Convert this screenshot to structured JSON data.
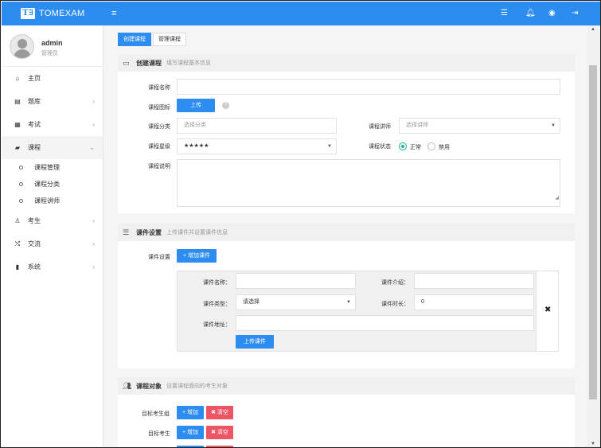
{
  "app": {
    "logo_mark": "T∃",
    "title": "TOMEXAM"
  },
  "topbar": {
    "menu_icon": "hamburger-icon",
    "icons": [
      "list-icon",
      "bell-icon",
      "user-circle-icon",
      "logout-icon"
    ]
  },
  "user": {
    "name": "admin",
    "role": "管理员"
  },
  "sidebar": {
    "items": [
      {
        "label": "主页",
        "icon": "home-icon",
        "glyph": "⌂"
      },
      {
        "label": "题库",
        "icon": "database-icon",
        "glyph": "▤"
      },
      {
        "label": "考试",
        "icon": "calendar-icon",
        "glyph": "▦"
      },
      {
        "label": "课程",
        "icon": "book-icon",
        "glyph": "▰"
      },
      {
        "label": "考生",
        "icon": "user-icon",
        "glyph": "♙"
      },
      {
        "label": "交流",
        "icon": "shuffle-icon",
        "glyph": "⤭"
      },
      {
        "label": "系统",
        "icon": "mobile-icon",
        "glyph": "▮"
      }
    ],
    "sub_items": [
      "课程管理",
      "课程分类",
      "课程讲师"
    ]
  },
  "tabs": {
    "create": "创建课程",
    "manage": "管理课程"
  },
  "section1": {
    "title": "创建课程",
    "subtitle": "填写课程基本信息",
    "name_label": "课程名称",
    "icon_label": "课程图标",
    "upload_label": "上传",
    "category_label": "课程分类",
    "category_placeholder": "选择分类",
    "teacher_label": "课程讲师",
    "teacher_placeholder": "选择讲师",
    "level_label": "课程星级",
    "level_value": "★★★★★",
    "status_label": "课程状态",
    "status_normal": "正常",
    "status_disabled": "禁用",
    "desc_label": "课程说明"
  },
  "section2": {
    "title": "课件设置",
    "subtitle": "上传课件并设置课件信息",
    "setting_label": "课件设置",
    "add_button": "+ 增加课件",
    "cw_name_label": "课件名称：",
    "cw_intro_label": "课件介绍：",
    "cw_type_label": "课件类型：",
    "cw_type_placeholder": "请选择",
    "cw_duration_label": "课件时长：",
    "cw_duration_value": "0",
    "cw_url_label": "课件地址：",
    "cw_upload_button": "上传课件",
    "remove_icon": "close-icon"
  },
  "section3": {
    "title": "课程对象",
    "subtitle": "设置课程面向的考生对象",
    "group_label": "目标考生组",
    "student_label": "目标考生",
    "add_button": "+ 增加",
    "clear_button": "✖ 清空"
  }
}
